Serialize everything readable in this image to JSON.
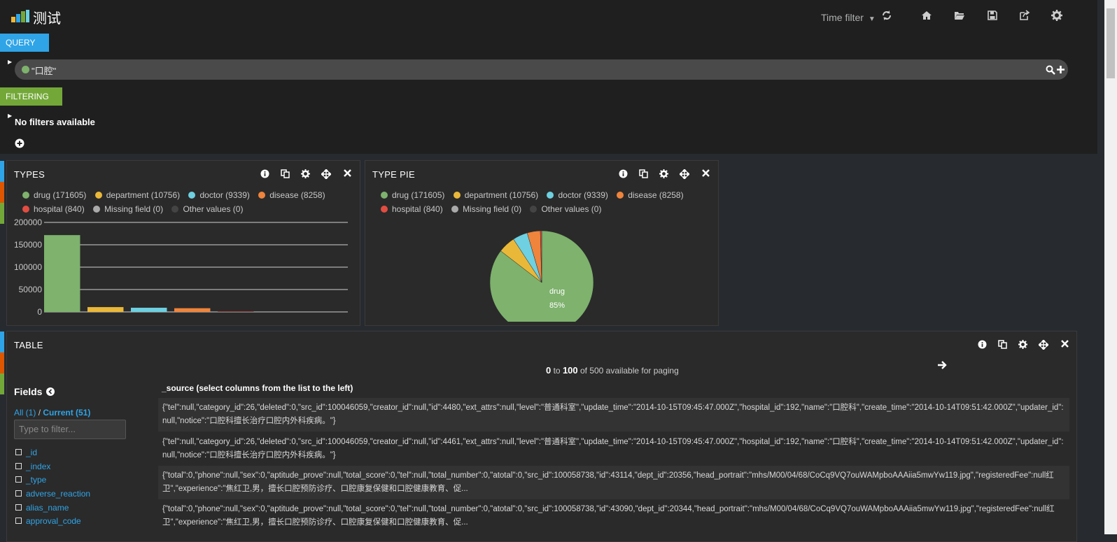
{
  "app": {
    "title": "测试"
  },
  "nav": {
    "time_filter": "Time filter",
    "icons": [
      "refresh-icon",
      "home-icon",
      "folder-open-icon",
      "save-icon",
      "share-icon",
      "gear-icon"
    ]
  },
  "query": {
    "label": "QUERY",
    "value": "\"口腔\"",
    "dot_color": "#7eb26d"
  },
  "filtering": {
    "label": "FILTERING",
    "empty_text": "No filters available"
  },
  "legend": [
    {
      "label": "drug (171605)",
      "color": "#7eb26d"
    },
    {
      "label": "department (10756)",
      "color": "#eab839"
    },
    {
      "label": "doctor (9339)",
      "color": "#6ed0e0"
    },
    {
      "label": "disease (8258)",
      "color": "#ef843c"
    },
    {
      "label": "hospital (840)",
      "color": "#e24d42"
    },
    {
      "label": "Missing field (0)",
      "color": "#aaaaaa"
    },
    {
      "label": "Other values (0)",
      "color": "#444444"
    }
  ],
  "types_panel": {
    "title": "TYPES"
  },
  "pie_panel": {
    "title": "TYPE PIE",
    "slice_label": "drug",
    "slice_pct": "85%"
  },
  "chart_data": [
    {
      "type": "bar",
      "title": "TYPES",
      "categories": [
        "drug",
        "department",
        "doctor",
        "disease",
        "hospital",
        "Missing field",
        "Other values"
      ],
      "values": [
        171605,
        10756,
        9339,
        8258,
        840,
        0,
        0
      ],
      "colors": [
        "#7eb26d",
        "#eab839",
        "#6ed0e0",
        "#ef843c",
        "#e24d42",
        "#aaaaaa",
        "#444444"
      ],
      "y_ticks": [
        "200000",
        "150000",
        "100000",
        "50000",
        "0"
      ],
      "ylim": [
        0,
        200000
      ],
      "grid": true
    },
    {
      "type": "pie",
      "title": "TYPE PIE",
      "categories": [
        "drug",
        "department",
        "doctor",
        "disease",
        "hospital"
      ],
      "values": [
        171605,
        10756,
        9339,
        8258,
        840
      ],
      "colors": [
        "#7eb26d",
        "#eab839",
        "#6ed0e0",
        "#ef843c",
        "#e24d42"
      ]
    }
  ],
  "table_panel": {
    "title": "TABLE",
    "paging_from": "0",
    "paging_to_word": "to",
    "paging_to": "100",
    "paging_rest": "of 500 available for paging",
    "fields_title": "Fields",
    "all_label": "All (1)",
    "separator": "/",
    "current_label": "Current (51)",
    "filter_placeholder": "Type to filter...",
    "fields": [
      "_id",
      "_index",
      "_type",
      "adverse_reaction",
      "alias_name",
      "approval_code"
    ],
    "source_header": "_source (select columns from the list to the left)",
    "rows": [
      "{\"tel\":null,\"category_id\":26,\"deleted\":0,\"src_id\":100046059,\"creator_id\":null,\"id\":4480,\"ext_attrs\":null,\"level\":\"普通科室\",\"update_time\":\"2014-10-15T09:45:47.000Z\",\"hospital_id\":192,\"name\":\"口腔科\",\"create_time\":\"2014-10-14T09:51:42.000Z\",\"updater_id\":null,\"notice\":\"口腔科擅长治疗口腔内外科疾病。\"}",
      "{\"tel\":null,\"category_id\":26,\"deleted\":0,\"src_id\":100046059,\"creator_id\":null,\"id\":4461,\"ext_attrs\":null,\"level\":\"普通科室\",\"update_time\":\"2014-10-15T09:45:47.000Z\",\"hospital_id\":192,\"name\":\"口腔科\",\"create_time\":\"2014-10-14T09:51:42.000Z\",\"updater_id\":null,\"notice\":\"口腔科擅长治疗口腔内外科疾病。\"}",
      "{\"total\":0,\"phone\":null,\"sex\":0,\"aptitude_prove\":null,\"total_score\":0,\"tel\":null,\"total_number\":0,\"atotal\":0,\"src_id\":100058738,\"id\":43114,\"dept_id\":20356,\"head_portrait\":\"mhs/M00/04/68/CoCq9VQ7ouWAMpboAAAiia5mwYw119.jpg\",\"registeredFee\":null红卫\",\"experience\":\"焦红卫,男，擅长口腔预防诊疗、口腔康复保健和口腔健康教育、促...",
      "{\"total\":0,\"phone\":null,\"sex\":0,\"aptitude_prove\":null,\"total_score\":0,\"tel\":null,\"total_number\":0,\"atotal\":0,\"src_id\":100058738,\"id\":43090,\"dept_id\":20344,\"head_portrait\":\"mhs/M00/04/68/CoCq9VQ7ouWAMpboAAAiia5mwYw119.jpg\",\"registeredFee\":null红卫\",\"experience\":\"焦红卫,男，擅长口腔预防诊疗、口腔康复保健和口腔健康教育、促..."
    ]
  }
}
